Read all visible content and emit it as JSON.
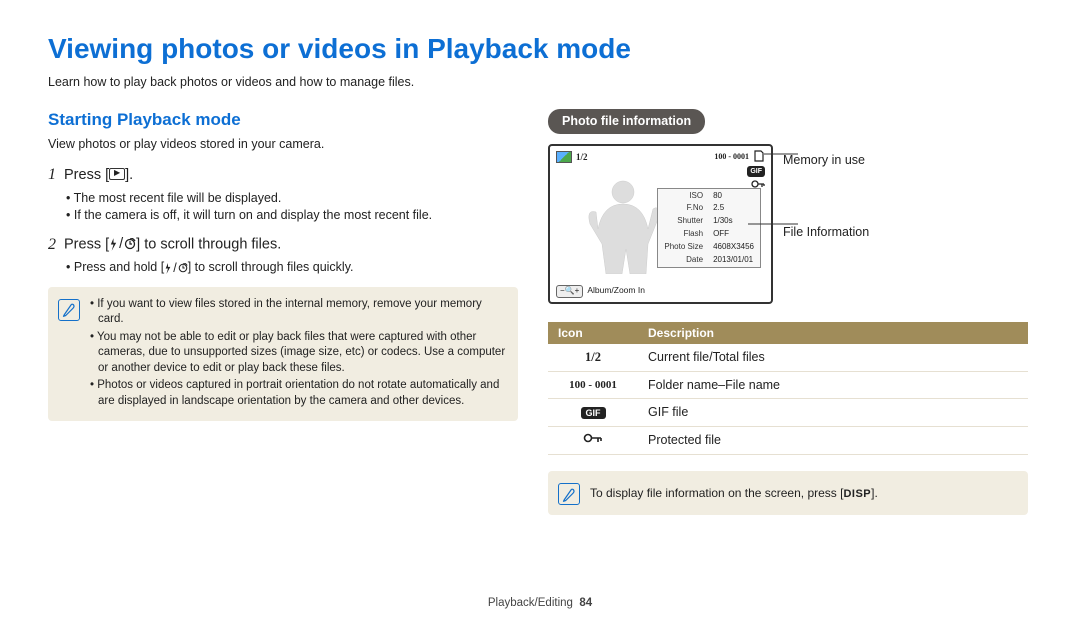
{
  "title": "Viewing photos or videos in Playback mode",
  "subtitle": "Learn how to play back photos or videos and how to manage files.",
  "section": {
    "heading": "Starting Playback mode",
    "intro": "View photos or play videos stored in your camera."
  },
  "steps": {
    "s1": {
      "num": "1",
      "textA": "Press [",
      "textB": "].",
      "b1": "The most recent file will be displayed.",
      "b2": "If the camera is off, it will turn on and display the most recent file."
    },
    "s2": {
      "num": "2",
      "textA": "Press [",
      "textB": "] to scroll through files.",
      "b1_a": "Press and hold [",
      "b1_b": "] to scroll through files quickly."
    }
  },
  "notes": {
    "n1": "If you want to view files stored in the internal memory, remove your memory card.",
    "n2": "You may not be able to edit or play back files that were captured with other cameras, due to unsupported sizes (image size, etc) or codecs. Use a computer or another device to edit or play back these files.",
    "n3": "Photos or videos captured in portrait orientation do not rotate automatically and are displayed in landscape orientation by the camera and other devices."
  },
  "right": {
    "pill": "Photo file information",
    "callout1": "Memory in use",
    "callout2": "File Information",
    "lcd": {
      "counter": "1/2",
      "folder_file": "100 - 0001",
      "gif": "GIF",
      "bottom": "Album/Zoom In",
      "info": {
        "iso_l": "ISO",
        "iso_v": "80",
        "fno_l": "F.No",
        "fno_v": "2.5",
        "shut_l": "Shutter",
        "shut_v": "1/30s",
        "flash_l": "Flash",
        "flash_v": "OFF",
        "size_l": "Photo Size",
        "size_v": "4608X3456",
        "date_l": "Date",
        "date_v": "2013/01/01"
      }
    },
    "table": {
      "h1": "Icon",
      "h2": "Description",
      "r1_icon": "1/2",
      "r1_desc": "Current file/Total files",
      "r2_icon": "100 - 0001",
      "r2_desc": "Folder name–File name",
      "r3_icon": "GIF",
      "r3_desc": "GIF file",
      "r4_desc": "Protected file"
    },
    "tipA": "To display file information on the screen, press [",
    "tipB": "DISP",
    "tipC": "]."
  },
  "footer": {
    "section": "Playback/Editing",
    "page": "84"
  }
}
